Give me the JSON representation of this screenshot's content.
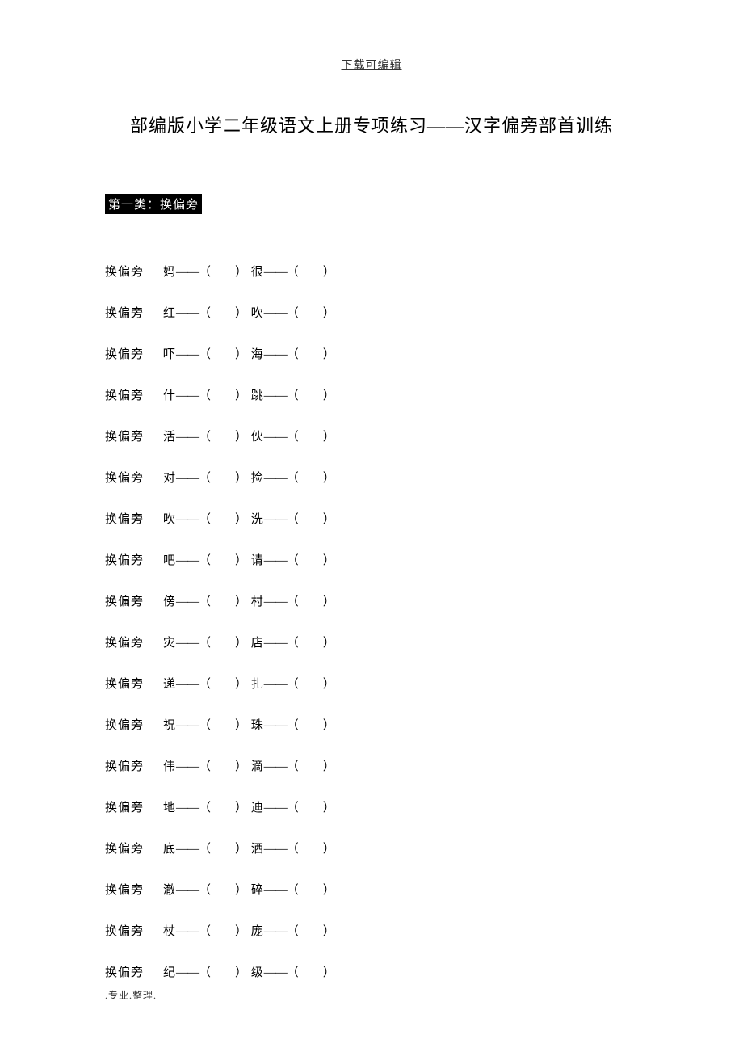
{
  "header": "下载可编辑",
  "title": "部编版小学二年级语文上册专项练习——汉字偏旁部首训练",
  "section_label": "第一类：换偏旁",
  "row_label": "换偏旁",
  "dash": "——",
  "blank_open": "（",
  "blank_inner": "　　",
  "blank_close": "）",
  "rows": [
    {
      "a": "妈",
      "b": "很"
    },
    {
      "a": "红",
      "b": "吹"
    },
    {
      "a": "吓",
      "b": "海"
    },
    {
      "a": "什",
      "b": "跳"
    },
    {
      "a": "活",
      "b": "伙"
    },
    {
      "a": "对",
      "b": "捡"
    },
    {
      "a": "吹",
      "b": "洗"
    },
    {
      "a": "吧",
      "b": "请"
    },
    {
      "a": "傍",
      "b": "村"
    },
    {
      "a": "灾",
      "b": "店"
    },
    {
      "a": "递",
      "b": "扎"
    },
    {
      "a": "祝",
      "b": "珠"
    },
    {
      "a": "伟",
      "b": "滴"
    },
    {
      "a": "地",
      "b": "迪"
    },
    {
      "a": "底",
      "b": "洒"
    },
    {
      "a": "澈",
      "b": "碎"
    },
    {
      "a": "杖",
      "b": "庞"
    },
    {
      "a": "纪",
      "b": "级"
    }
  ],
  "footer": ".专业.整理."
}
